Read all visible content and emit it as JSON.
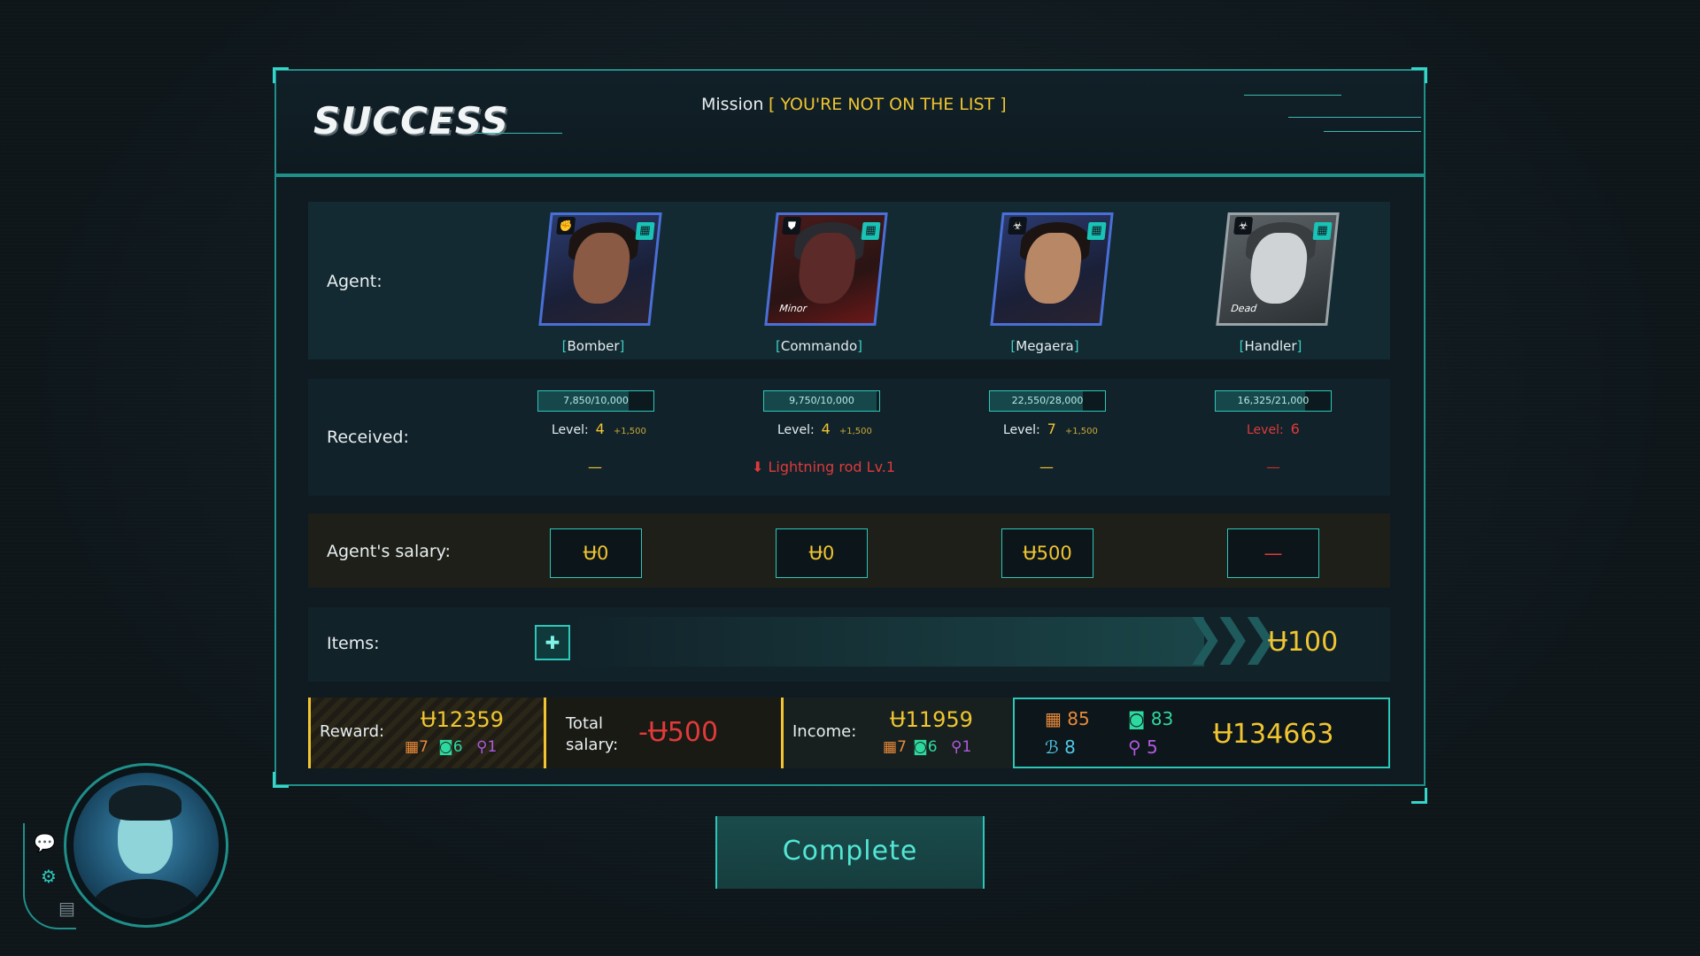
{
  "header": {
    "title": "SUCCESS",
    "mission_label": "Mission",
    "mission_name": "[ YOU'RE NOT ON THE LIST ]"
  },
  "rows": {
    "agent_label": "Agent:",
    "received_label": "Received:",
    "salary_label": "Agent's salary:",
    "items_label": "Items:"
  },
  "agents": [
    {
      "name": "Bomber",
      "status": "",
      "xp_text": "7,850/10,000",
      "xp_fraction": 0.785,
      "level_label": "Level:",
      "level": "4",
      "level_bonus": "+1,500",
      "received": "—",
      "salary": "Ʉ0"
    },
    {
      "name": "Commando",
      "status": "Minor",
      "xp_text": "9,750/10,000",
      "xp_fraction": 0.975,
      "level_label": "Level:",
      "level": "4",
      "level_bonus": "+1,500",
      "received": "⬇ Lightning rod Lv.1",
      "salary": "Ʉ0"
    },
    {
      "name": "Megaera",
      "status": "",
      "xp_text": "22,550/28,000",
      "xp_fraction": 0.805,
      "level_label": "Level:",
      "level": "7",
      "level_bonus": "+1,500",
      "received": "—",
      "salary": "Ʉ500"
    },
    {
      "name": "Handler",
      "status": "Dead",
      "xp_text": "16,325/21,000",
      "xp_fraction": 0.777,
      "level_label": "Level:",
      "level": "6",
      "level_bonus": "",
      "received": "—",
      "salary": "—"
    }
  ],
  "items": {
    "icon": "medkit-icon",
    "value": "Ʉ100"
  },
  "summary": {
    "reward_label": "Reward:",
    "reward_value": "Ʉ12359",
    "reward_res": [
      "7",
      "6",
      "1"
    ],
    "total_salary_label_1": "Total",
    "total_salary_label_2": "salary:",
    "total_salary_value": "-Ʉ500",
    "income_label": "Income:",
    "income_value": "Ʉ11959",
    "income_res": [
      "7",
      "6",
      "1"
    ],
    "totals": {
      "res_orange": "85",
      "res_green": "83",
      "res_blue": "8",
      "res_purple": "5",
      "money": "Ʉ134663"
    }
  },
  "complete_label": "Complete",
  "colors": {
    "accent": "#2cc7b9",
    "gold": "#f0c531",
    "danger": "#e03a3a"
  }
}
